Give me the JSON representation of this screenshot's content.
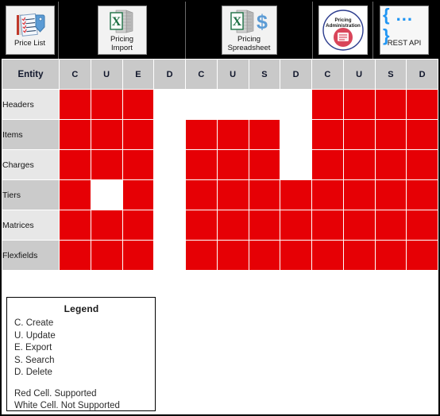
{
  "toolbar": {
    "apps": [
      {
        "id": "price-list",
        "label": "Price List",
        "icon": "clipboard-tag-icon"
      },
      {
        "id": "pricing-import",
        "label": "Pricing\nImport",
        "icon": "excel-document-icon"
      },
      {
        "id": "pricing-spreadsheet",
        "label": "Pricing\nSpreadsheet",
        "icon": "excel-dollar-icon"
      },
      {
        "id": "pricing-administration",
        "label": "",
        "icon": "pricing-administration-badge-icon",
        "badge_line1": "Pricing",
        "badge_line2": "Administration"
      },
      {
        "id": "rest-api",
        "label": "REST API",
        "icon": "curly-braces-icon",
        "glyph": "{ ... }"
      }
    ]
  },
  "matrix": {
    "entity_header": "Entity",
    "column_headers": [
      "C",
      "U",
      "E",
      "D",
      "C",
      "U",
      "S",
      "D",
      "C",
      "U",
      "S",
      "D"
    ],
    "rows": [
      {
        "entity": "Headers",
        "cells": [
          1,
          1,
          1,
          0,
          0,
          0,
          0,
          0,
          1,
          1,
          1,
          1
        ]
      },
      {
        "entity": "Items",
        "cells": [
          1,
          1,
          1,
          0,
          1,
          1,
          1,
          0,
          1,
          1,
          1,
          1
        ]
      },
      {
        "entity": "Charges",
        "cells": [
          1,
          1,
          1,
          0,
          1,
          1,
          1,
          0,
          1,
          1,
          1,
          1
        ]
      },
      {
        "entity": "Tiers",
        "cells": [
          1,
          0,
          1,
          0,
          1,
          1,
          1,
          1,
          1,
          1,
          1,
          1
        ]
      },
      {
        "entity": "Matrices",
        "cells": [
          1,
          1,
          1,
          0,
          1,
          1,
          1,
          1,
          1,
          1,
          1,
          1
        ]
      },
      {
        "entity": "Flexfields",
        "cells": [
          1,
          1,
          1,
          0,
          1,
          1,
          1,
          1,
          1,
          1,
          1,
          1
        ]
      }
    ]
  },
  "legend": {
    "title": "Legend",
    "keys": [
      "C. Create",
      "U. Update",
      "E. Export",
      "S. Search",
      "D. Delete"
    ],
    "notes": [
      "Red Cell. Supported",
      "White Cell. Not Supported"
    ]
  },
  "colors": {
    "supported": "#e60005",
    "not_supported": "#ffffff",
    "header_bg": "#c9c9c9",
    "row_shade_light": "#e7e7e7",
    "row_shade_dark": "#cbcbcb",
    "toolbar_bg": "#000000"
  }
}
